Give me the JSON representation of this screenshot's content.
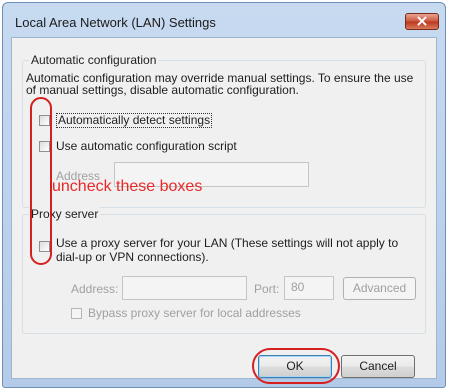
{
  "dialog": {
    "title": "Local Area Network (LAN) Settings",
    "close_icon": "close-x-icon"
  },
  "auto_config": {
    "group_label": "Automatic configuration",
    "description": "Automatic configuration may override manual settings.  To ensure the use of manual settings, disable automatic configuration.",
    "auto_detect": {
      "label": "Automatically detect settings",
      "checked": false
    },
    "use_script": {
      "label": "Use automatic configuration script",
      "checked": false
    },
    "address_label": "Address",
    "address_value": ""
  },
  "proxy": {
    "group_label": "Proxy server",
    "use_proxy": {
      "label_line1": "Use a proxy server for your LAN (These settings will not apply to",
      "label_line2": "dial-up or VPN connections).",
      "checked": false
    },
    "address_label": "Address:",
    "address_value": "",
    "port_label": "Port:",
    "port_value": "80",
    "advanced_label": "Advanced",
    "bypass": {
      "label": "Bypass proxy server for local addresses",
      "checked": false
    }
  },
  "buttons": {
    "ok": "OK",
    "cancel": "Cancel"
  },
  "annotation": {
    "text": "uncheck these boxes",
    "color": "#e8292a"
  }
}
